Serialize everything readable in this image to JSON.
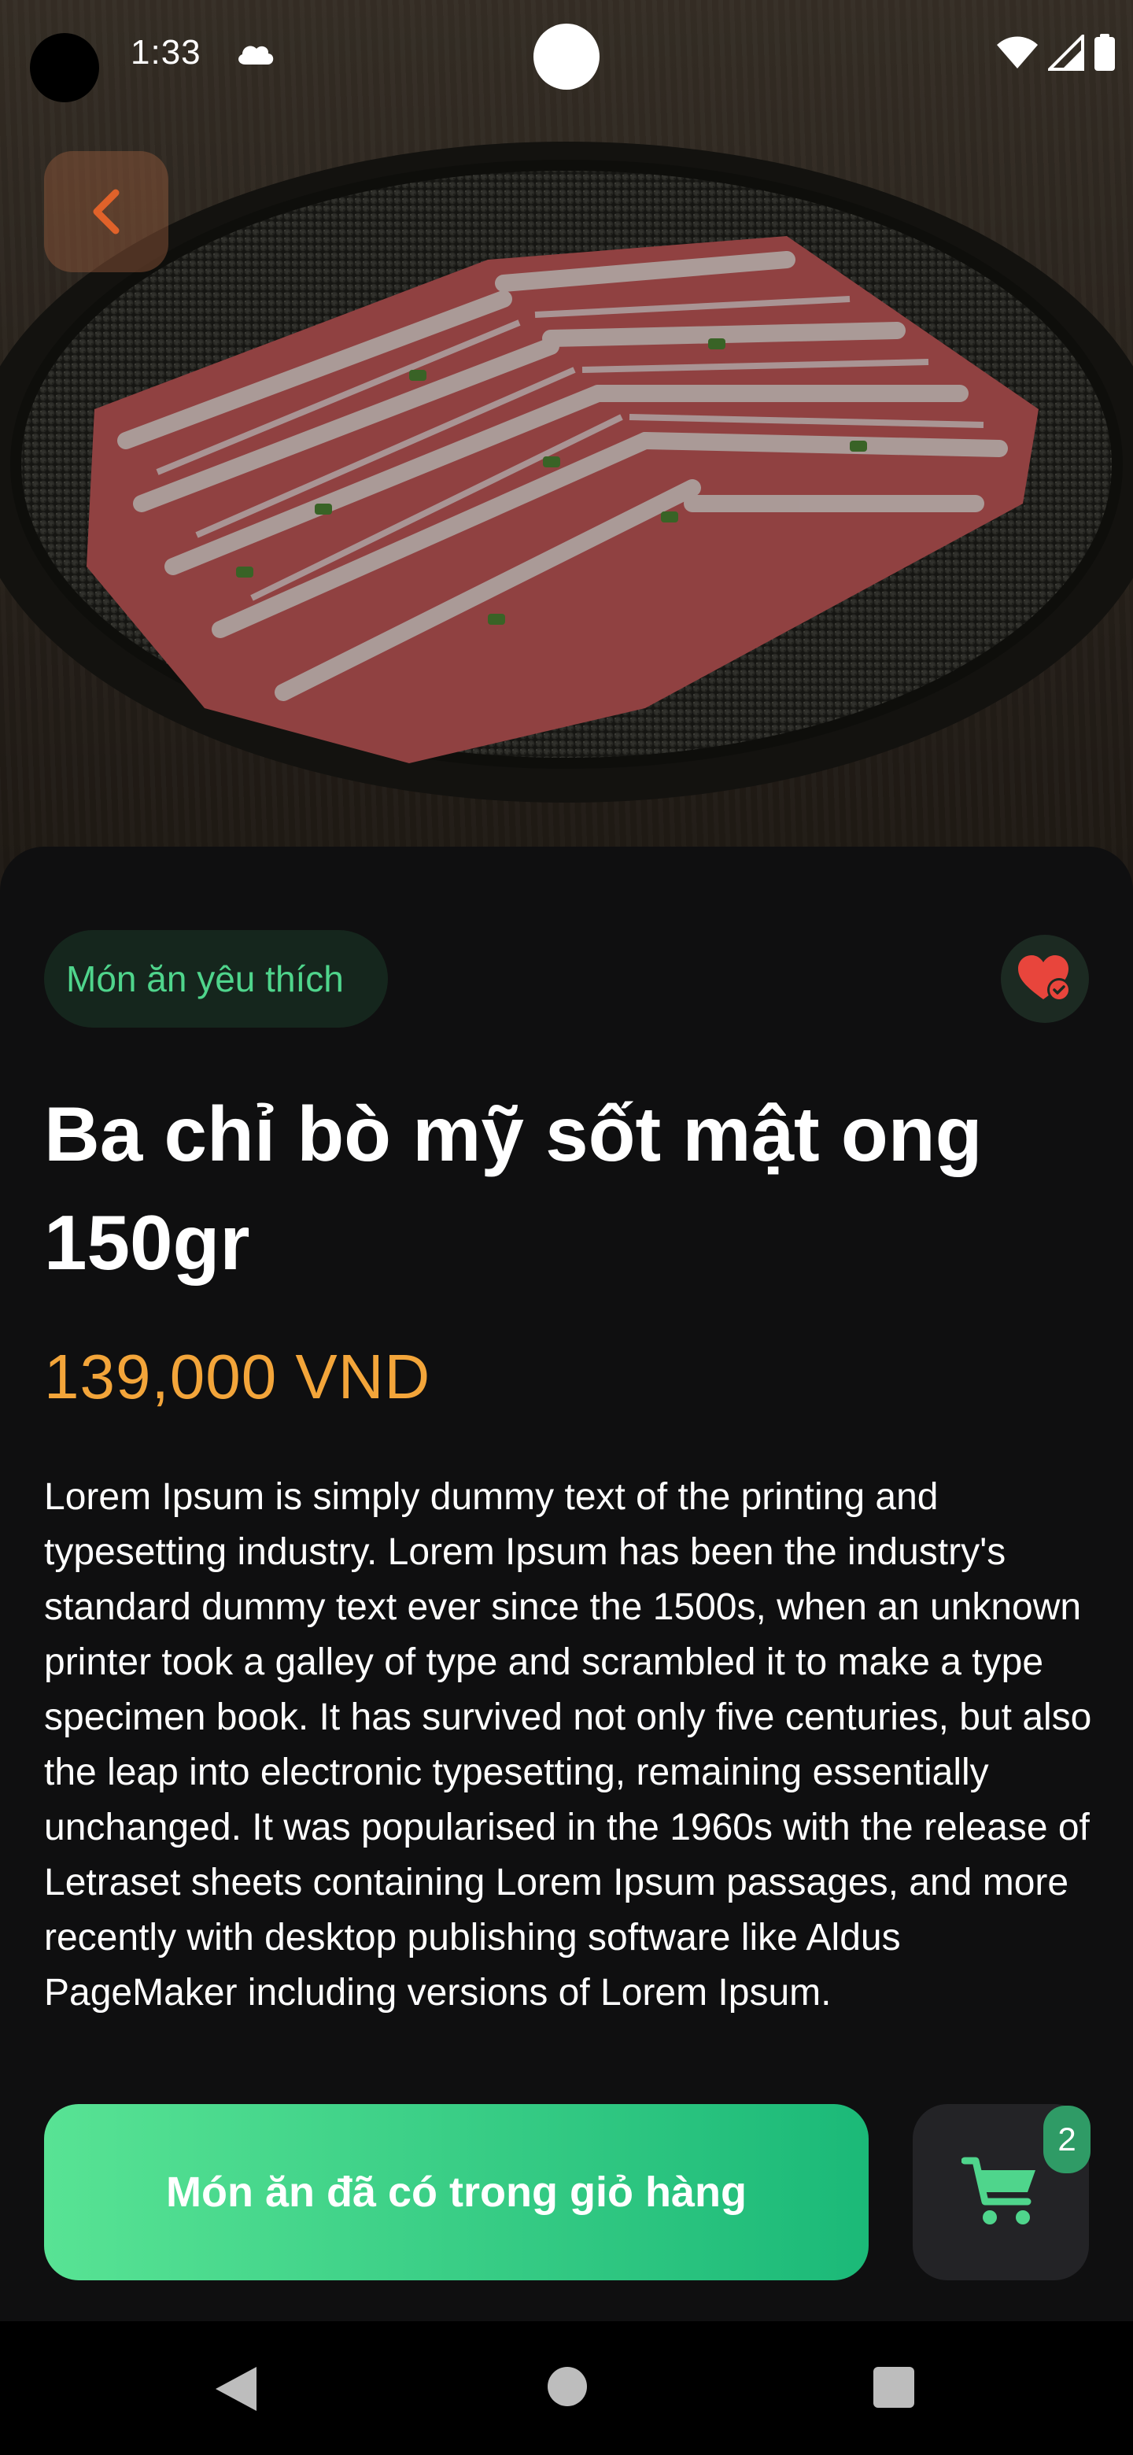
{
  "status_bar": {
    "time": "1:33"
  },
  "product": {
    "favorite_chip": "Món ăn yêu thích",
    "title": "Ba chỉ bò mỹ sốt mật ong 150gr",
    "price": "139,000 VND",
    "description": "Lorem Ipsum is simply dummy text of the printing and typesetting industry. Lorem Ipsum has been the industry's standard dummy text ever since the 1500s, when an unknown printer took a galley of type and scrambled it to make a type specimen book. It has survived not only five centuries, but also the leap into electronic typesetting, remaining essentially unchanged. It was popularised in the 1960s with the release of Letraset sheets containing Lorem Ipsum passages, and more recently with desktop publishing software like Aldus PageMaker including versions of Lorem Ipsum."
  },
  "action_bar": {
    "cart_button_label": "Món ăn đã có trong giỏ hàng",
    "cart_count": "2"
  },
  "icons": {
    "back": "chevron-left-icon",
    "favorite": "heart-check-icon",
    "cart": "shopping-cart-icon",
    "weather": "cloud-icon",
    "wifi": "wifi-icon",
    "signal": "signal-icon",
    "battery": "battery-icon"
  },
  "colors": {
    "accent_green": "#4fd58c",
    "price_orange": "#f3a53a",
    "back_orange": "#e0622a",
    "heart_red": "#e8453c",
    "background": "#0f0f10"
  }
}
